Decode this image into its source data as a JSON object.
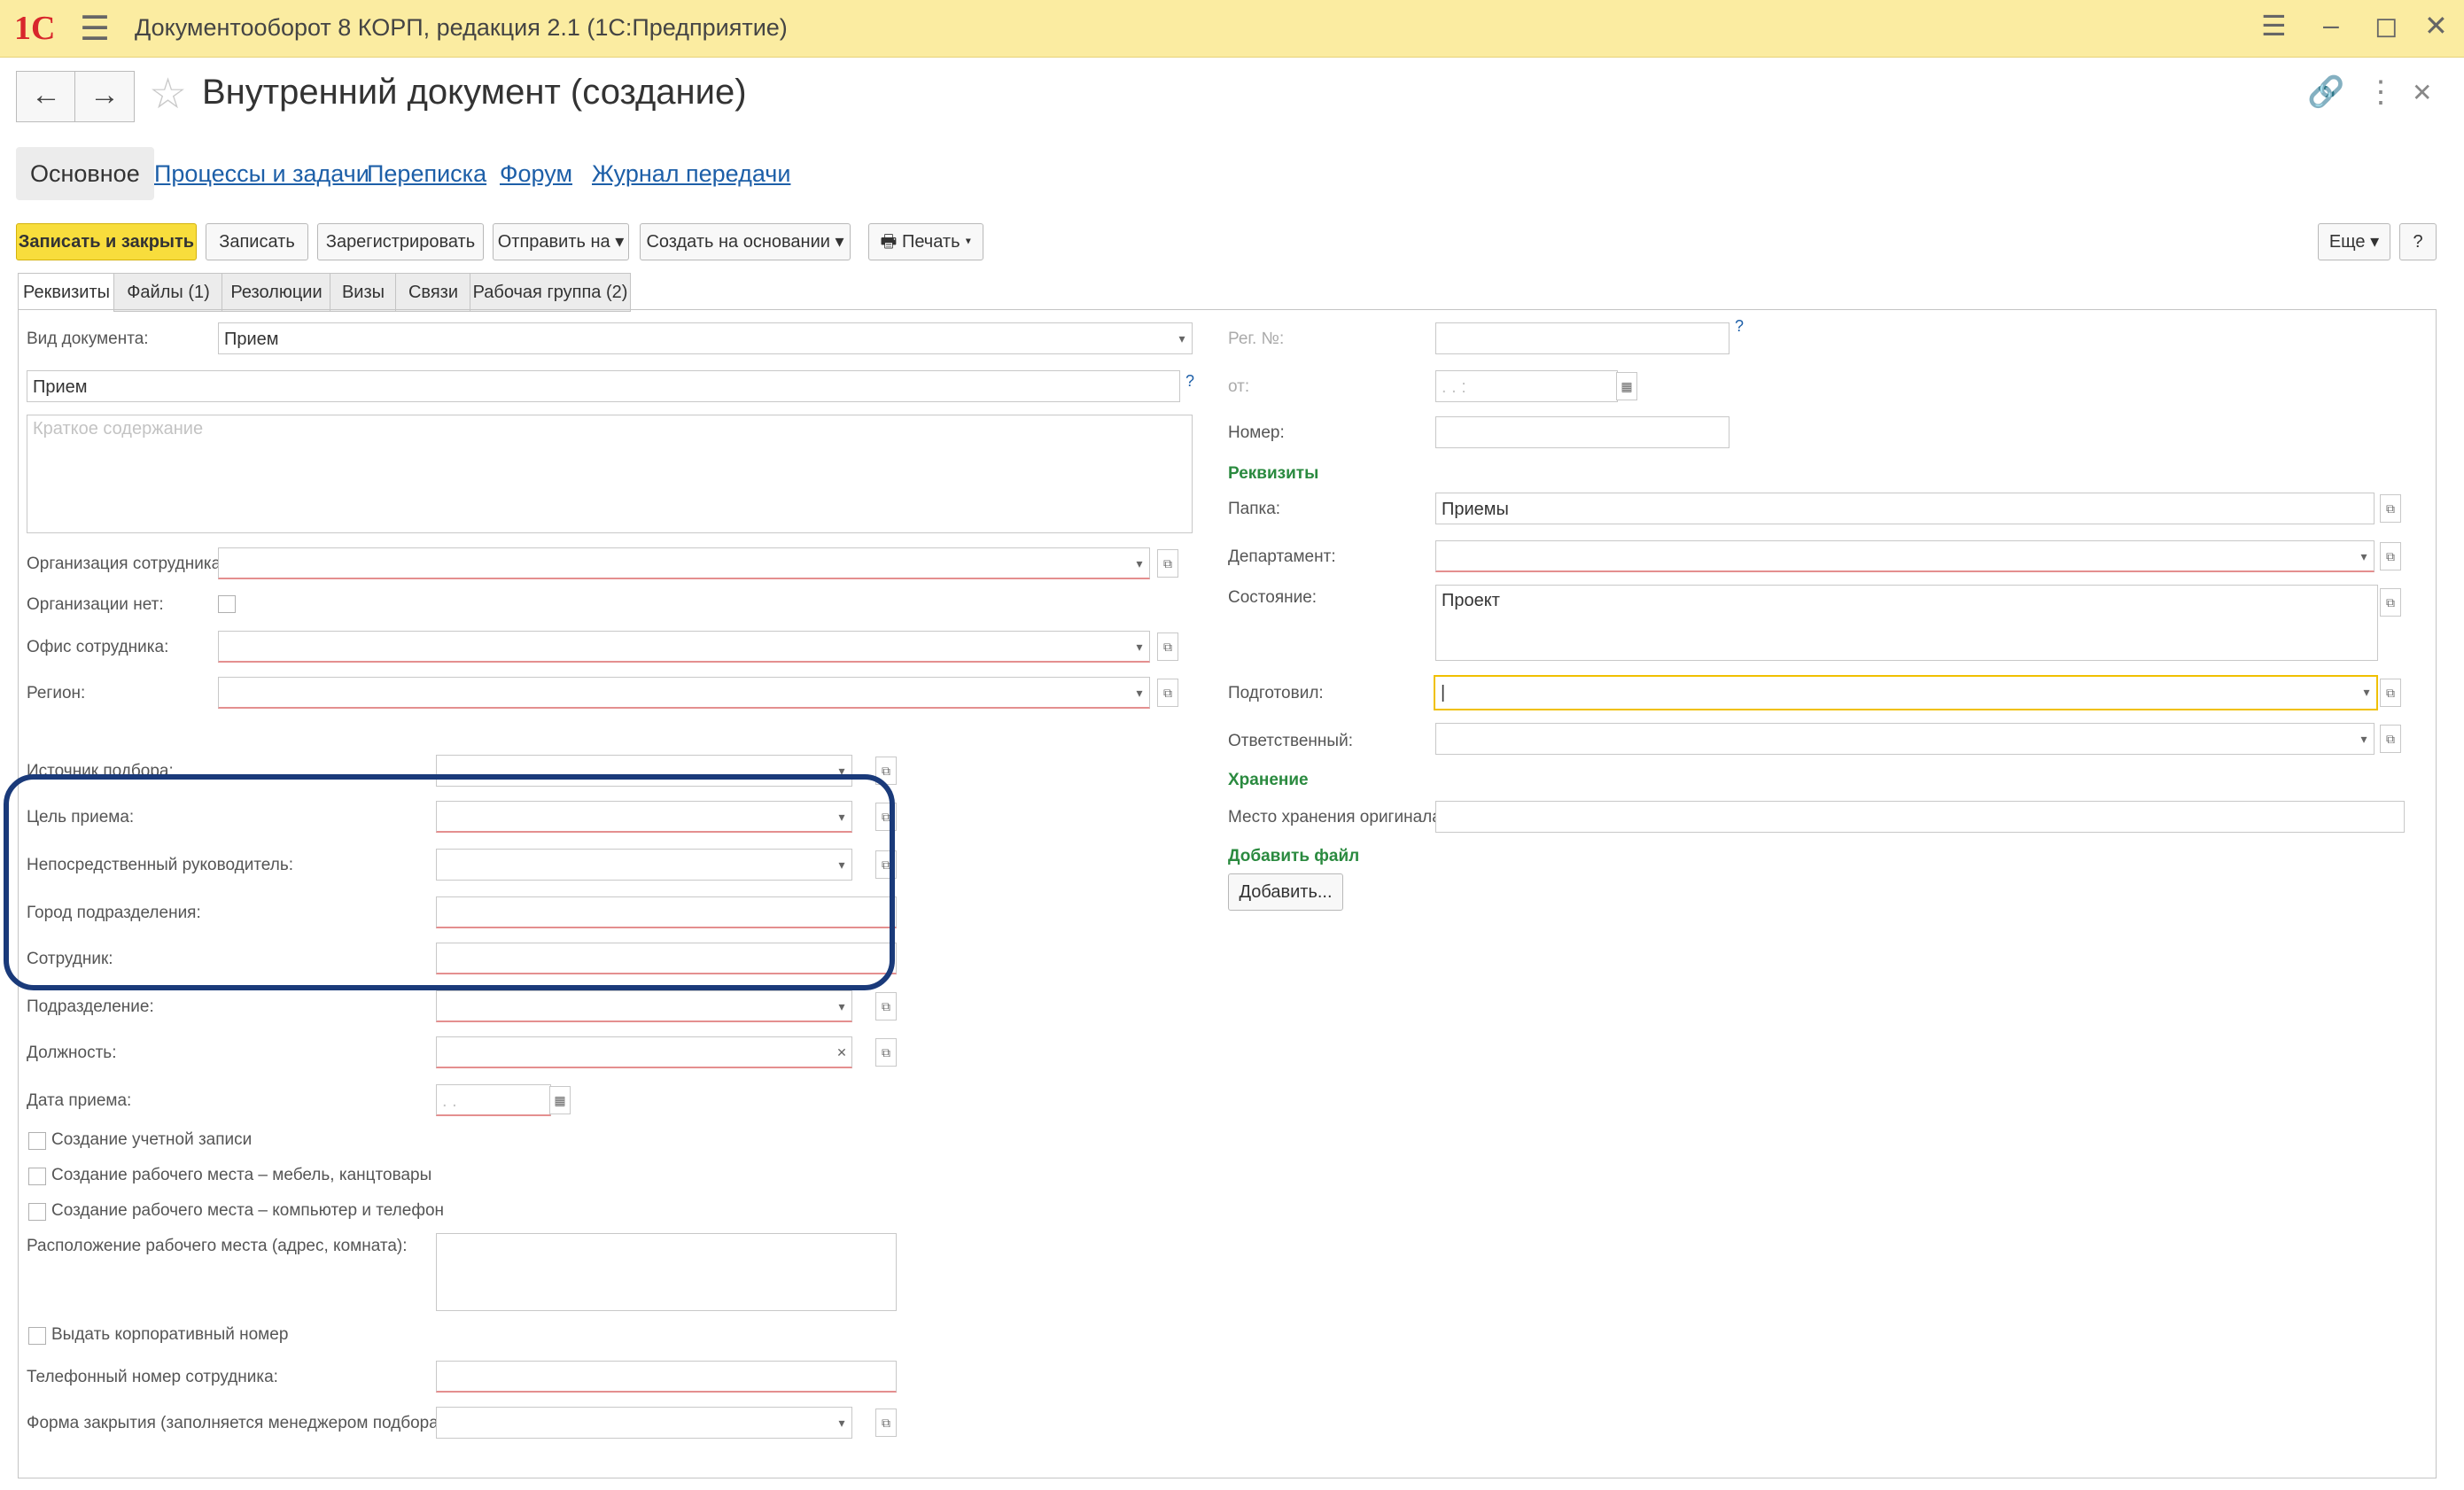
{
  "window": {
    "logo": "1С",
    "title": "Документооборот 8 КОРП, редакция 2.1  (1С:Предприятие)"
  },
  "header": {
    "form_title": "Внутренний документ (создание)"
  },
  "sections": [
    "Основное",
    "Процессы и задачи",
    "Переписка",
    "Форум",
    "Журнал передачи"
  ],
  "commands": {
    "save_close": "Записать и закрыть",
    "save": "Записать",
    "register": "Зарегистрировать",
    "send_to": "Отправить на",
    "create_based": "Создать на основании",
    "print": "Печать",
    "more": "Еще",
    "help": "?"
  },
  "tabs": [
    "Реквизиты",
    "Файлы (1)",
    "Резолюции",
    "Визы",
    "Связи",
    "Рабочая группа (2)"
  ],
  "left": {
    "doc_type_label": "Вид документа:",
    "doc_type_value": "Прием",
    "title_value": "Прием",
    "summary_placeholder": "Краткое содержание",
    "org_label": "Организация сотрудника:",
    "no_org_label": "Организации нет:",
    "office_label": "Офис сотрудника:",
    "region_label": "Регион:",
    "source_label": "Источник подбора:",
    "goal_label": "Цель приема:",
    "manager_label": "Непосредственный руководитель:",
    "city_label": "Город подразделения:",
    "employee_label": "Сотрудник:",
    "division_label": "Подразделение:",
    "position_label": "Должность:",
    "hire_date_label": "Дата приема:",
    "hire_date_placeholder": ". .",
    "chk_account": "Создание учетной записи",
    "chk_furniture": "Создание рабочего места – мебель, канцтовары",
    "chk_computer": "Создание рабочего места – компьютер и телефон",
    "workplace_label": "Расположение рабочего места (адрес, комната):",
    "chk_corp_number": "Выдать корпоративный номер",
    "phone_label": "Телефонный номер сотрудника:",
    "closing_form_label": "Форма закрытия (заполняется менеджером подбора):"
  },
  "right": {
    "reg_no_label": "Рег. №:",
    "from_label": "от:",
    "from_placeholder": ". .  :",
    "number_label": "Номер:",
    "requisites_group": "Реквизиты",
    "folder_label": "Папка:",
    "folder_value": "Приемы",
    "department_label": "Департамент:",
    "state_label": "Состояние:",
    "state_value": "Проект",
    "prepared_label": "Подготовил:",
    "responsible_label": "Ответственный:",
    "storage_group": "Хранение",
    "storage_place_label": "Место хранения оригинала:",
    "add_file_group": "Добавить файл",
    "add_button": "Добавить..."
  },
  "colors": {
    "titlebar": "#fbeca1",
    "primary_button": "#f8dd3c",
    "link": "#1d5fa8",
    "group_header": "#2a8a3f",
    "required_underline": "#e48f8f",
    "highlight_frame": "#1a3a7a"
  }
}
